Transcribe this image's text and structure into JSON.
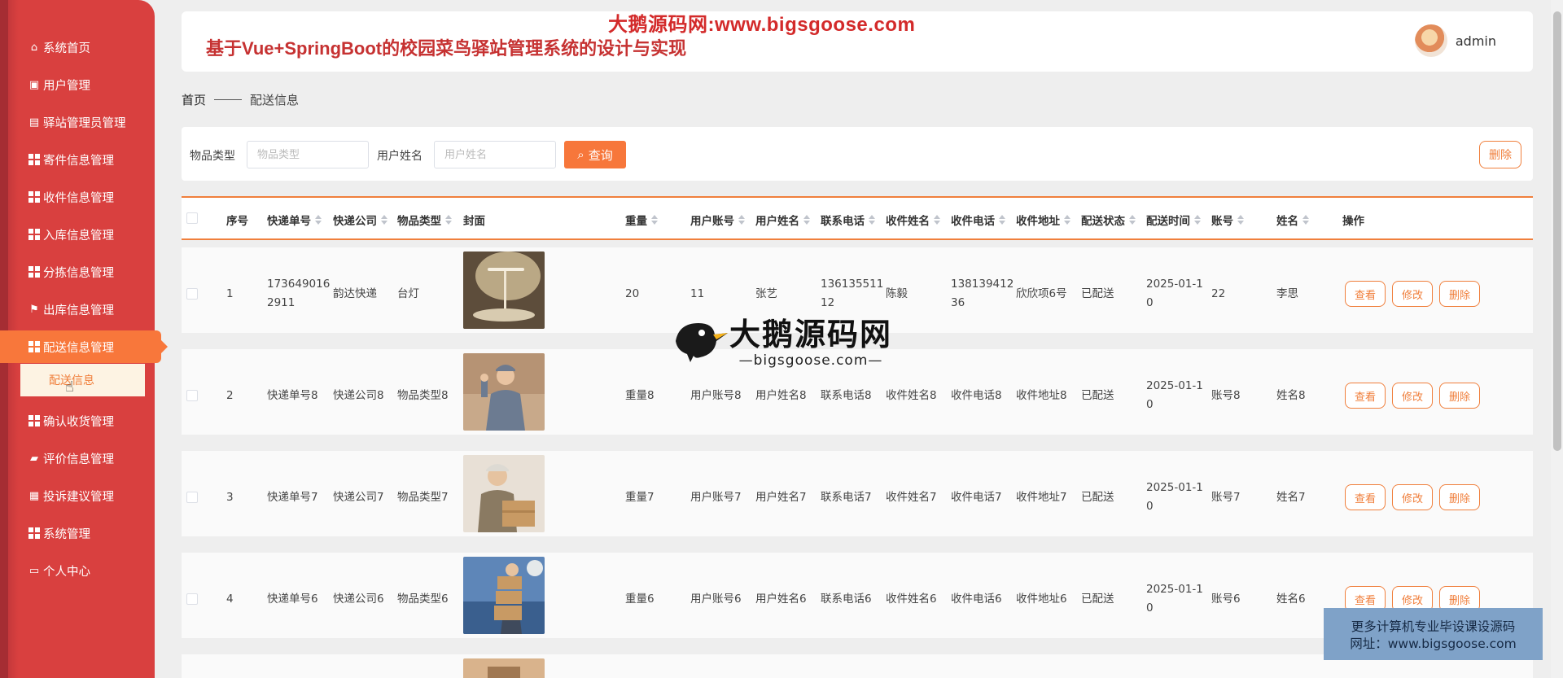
{
  "banner": "大鹅源码网:www.bigsgoose.com",
  "app_title": "基于Vue+SpringBoot的校园菜鸟驿站管理系统的设计与实现",
  "user": {
    "name": "admin"
  },
  "sidebar": {
    "items": [
      {
        "label": "系统首页",
        "icon": "home-icon"
      },
      {
        "label": "用户管理",
        "icon": "user-icon"
      },
      {
        "label": "驿站管理员管理",
        "icon": "briefcase-icon"
      },
      {
        "label": "寄件信息管理",
        "icon": "grid-icon"
      },
      {
        "label": "收件信息管理",
        "icon": "grid-icon"
      },
      {
        "label": "入库信息管理",
        "icon": "grid-icon"
      },
      {
        "label": "分拣信息管理",
        "icon": "grid-icon"
      },
      {
        "label": "出库信息管理",
        "icon": "flag-icon"
      },
      {
        "label": "配送信息管理",
        "icon": "grid-icon",
        "active": true
      },
      {
        "label": "确认收货管理",
        "icon": "grid-icon"
      },
      {
        "label": "评价信息管理",
        "icon": "wallet-icon"
      },
      {
        "label": "投诉建议管理",
        "icon": "clipboard-icon"
      },
      {
        "label": "系统管理",
        "icon": "grid-icon"
      },
      {
        "label": "个人中心",
        "icon": "card-icon"
      }
    ],
    "submenu_label": "配送信息"
  },
  "breadcrumb": {
    "home": "首页",
    "current": "配送信息"
  },
  "search": {
    "field1_label": "物品类型",
    "field1_placeholder": "物品类型",
    "field2_label": "用户姓名",
    "field2_placeholder": "用户姓名",
    "search_button": "查询",
    "delete_button": "删除"
  },
  "table": {
    "headers": [
      "序号",
      "快递单号",
      "快递公司",
      "物品类型",
      "封面",
      "重量",
      "用户账号",
      "用户姓名",
      "联系电话",
      "收件姓名",
      "收件电话",
      "收件地址",
      "配送状态",
      "配送时间",
      "账号",
      "姓名",
      "操作"
    ],
    "rows": [
      {
        "index": "1",
        "tracking": "1736490162911",
        "company": "韵达快递",
        "type": "台灯",
        "weight": "20",
        "account": "11",
        "username": "张艺",
        "phone": "13613551112",
        "recv_name": "陈毅",
        "recv_phone": "13813941236",
        "recv_addr": "欣欣项6号",
        "status": "已配送",
        "time": "2025-01-10",
        "acc": "22",
        "name": "李思"
      },
      {
        "index": "2",
        "tracking": "快递单号8",
        "company": "快递公司8",
        "type": "物品类型8",
        "weight": "重量8",
        "account": "用户账号8",
        "username": "用户姓名8",
        "phone": "联系电话8",
        "recv_name": "收件姓名8",
        "recv_phone": "收件电话8",
        "recv_addr": "收件地址8",
        "status": "已配送",
        "time": "2025-01-10",
        "acc": "账号8",
        "name": "姓名8"
      },
      {
        "index": "3",
        "tracking": "快递单号7",
        "company": "快递公司7",
        "type": "物品类型7",
        "weight": "重量7",
        "account": "用户账号7",
        "username": "用户姓名7",
        "phone": "联系电话7",
        "recv_name": "收件姓名7",
        "recv_phone": "收件电话7",
        "recv_addr": "收件地址7",
        "status": "已配送",
        "time": "2025-01-10",
        "acc": "账号7",
        "name": "姓名7"
      },
      {
        "index": "4",
        "tracking": "快递单号6",
        "company": "快递公司6",
        "type": "物品类型6",
        "weight": "重量6",
        "account": "用户账号6",
        "username": "用户姓名6",
        "phone": "联系电话6",
        "recv_name": "收件姓名6",
        "recv_phone": "收件电话6",
        "recv_addr": "收件地址6",
        "status": "已配送",
        "time": "2025-01-10",
        "acc": "账号6",
        "name": "姓名6"
      }
    ],
    "actions": {
      "view": "查看",
      "edit": "修改",
      "delete": "删除"
    }
  },
  "watermark": {
    "title": "大鹅源码网",
    "subtitle": "—bigsgoose.com—"
  },
  "promo": {
    "line1": "更多计算机专业毕设课设源码",
    "line2": "网址：www.bigsgoose.com"
  },
  "colors": {
    "sidebar": "#d9403f",
    "accent": "#f7773b",
    "title": "#c63232"
  }
}
